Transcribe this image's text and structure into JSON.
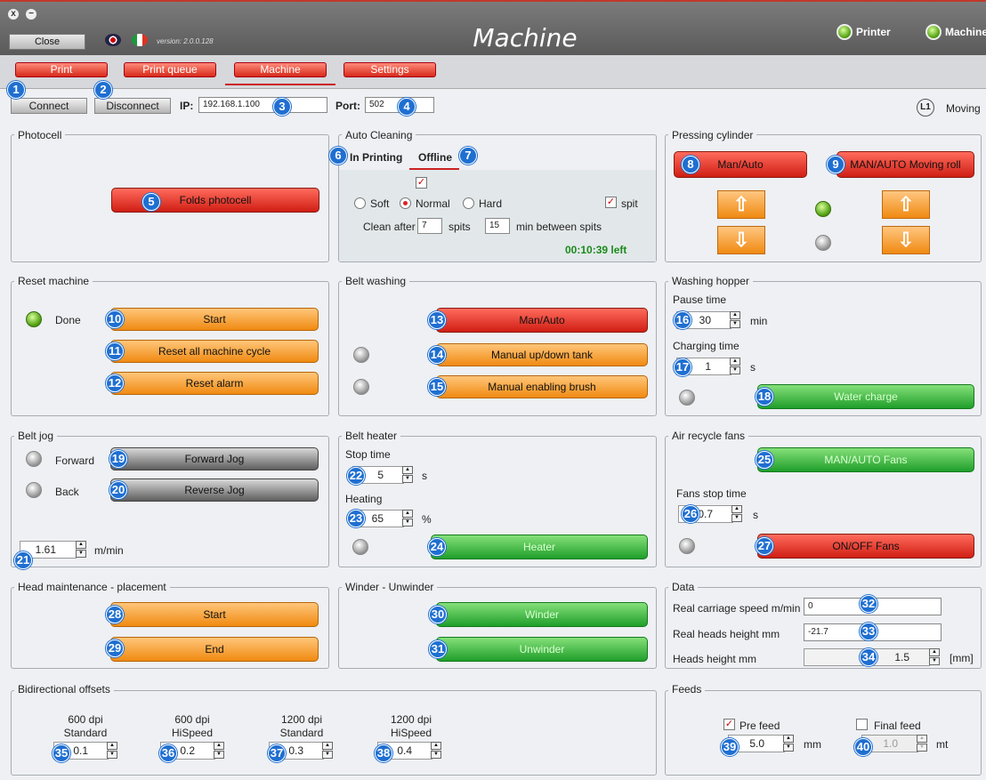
{
  "window": {
    "close_x": "x",
    "minimize": "−"
  },
  "header": {
    "close": "Close",
    "version": "version: 2.0.0.128",
    "title": "Machine",
    "printer": "Printer",
    "machine": "Machine"
  },
  "tabs": [
    "Print",
    "Print queue",
    "Machine",
    "Settings"
  ],
  "conn": {
    "connect": "Connect",
    "disconnect": "Disconnect",
    "ip_label": "IP:",
    "ip": "192.168.1.100",
    "port_label": "Port:",
    "port": "502",
    "moving": "Moving"
  },
  "badges": [
    "1",
    "2",
    "3",
    "4",
    "5",
    "6",
    "7",
    "8",
    "9",
    "10",
    "11",
    "12",
    "13",
    "14",
    "15",
    "16",
    "17",
    "18",
    "19",
    "20",
    "21",
    "22",
    "23",
    "24",
    "25",
    "26",
    "27",
    "28",
    "29",
    "30",
    "31",
    "32",
    "33",
    "34",
    "35",
    "36",
    "37",
    "38",
    "39",
    "40"
  ],
  "photocell": {
    "title": "Photocell",
    "folds": "Folds photocell"
  },
  "auto_cleaning": {
    "title": "Auto Cleaning",
    "tab_printing": "In Printing",
    "tab_offline": "Offline",
    "check_mark": "✓",
    "soft": "Soft",
    "normal": "Normal",
    "hard": "Hard",
    "spit": "spit",
    "clean_after": "Clean after",
    "spits_value": "7",
    "spits": "spits",
    "min_value": "15",
    "min_between": "min between spits",
    "time_left": "00:10:39 left"
  },
  "pressing": {
    "title": "Pressing cylinder",
    "man_auto": "Man/Auto",
    "moving_roll": "MAN/AUTO Moving roll",
    "up": "⇧",
    "down": "⇩"
  },
  "reset": {
    "title": "Reset machine",
    "done": "Done",
    "start": "Start",
    "reset_cycle": "Reset all machine cycle",
    "reset_alarm": "Reset alarm"
  },
  "belt_washing": {
    "title": "Belt washing",
    "man_auto": "Man/Auto",
    "manual_tank": "Manual up/down tank",
    "manual_brush": "Manual enabling brush"
  },
  "washing_hopper": {
    "title": "Washing hopper",
    "pause_label": "Pause time",
    "pause_value": "30",
    "pause_unit": "min",
    "charging_label": "Charging time",
    "charging_value": "1",
    "charging_unit": "s",
    "water_charge": "Water charge"
  },
  "belt_jog": {
    "title": "Belt jog",
    "forward": "Forward",
    "forward_jog": "Forward Jog",
    "back": "Back",
    "reverse_jog": "Reverse Jog",
    "speed_value": "1.61",
    "speed_unit": "m/min"
  },
  "belt_heater": {
    "title": "Belt heater",
    "stop_label": "Stop time",
    "stop_value": "5",
    "stop_unit": "s",
    "heating_label": "Heating",
    "heating_value": "65",
    "heating_unit": "%",
    "heater": "Heater"
  },
  "air_fans": {
    "title": "Air recycle fans",
    "man_auto": "MAN/AUTO Fans",
    "stop_label": "Fans stop time",
    "stop_value": "0.7",
    "stop_unit": "s",
    "on_off": "ON/OFF Fans"
  },
  "head_maint": {
    "title": "Head maintenance - placement",
    "start": "Start",
    "end": "End"
  },
  "winder": {
    "title": "Winder - Unwinder",
    "winder": "Winder",
    "unwinder": "Unwinder"
  },
  "data_panel": {
    "title": "Data",
    "carriage_label": "Real carriage speed m/min",
    "carriage_value": "0",
    "heads_real_label": "Real heads height mm",
    "heads_real_value": "-21.7",
    "heads_label": "Heads height mm",
    "heads_value": "1.5",
    "heads_unit": "[mm]"
  },
  "bidir": {
    "title": "Bidirectional offsets",
    "cols": [
      {
        "l1": "600 dpi",
        "l2": "Standard",
        "v": "0.1"
      },
      {
        "l1": "600 dpi",
        "l2": "HiSpeed",
        "v": "0.2"
      },
      {
        "l1": "1200 dpi",
        "l2": "Standard",
        "v": "0.3"
      },
      {
        "l1": "1200 dpi",
        "l2": "HiSpeed",
        "v": "0.4"
      }
    ]
  },
  "feeds": {
    "title": "Feeds",
    "pre_feed": "Pre feed",
    "pre_check": "✓",
    "pre_value": "5.0",
    "pre_unit": "mm",
    "final_feed": "Final feed",
    "final_value": "1.0",
    "final_unit": "mt"
  },
  "icons": {
    "up_spin": "▲",
    "down_spin": "▼",
    "l1": "L1"
  }
}
